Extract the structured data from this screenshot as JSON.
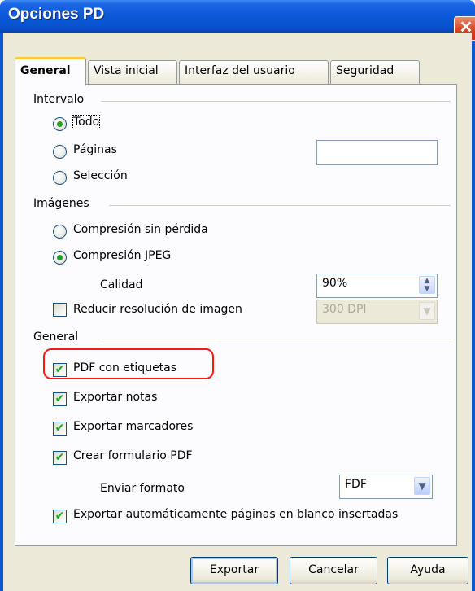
{
  "window": {
    "title": "Opciones PD",
    "close_glyph": "✕"
  },
  "tabs": [
    {
      "label": "General",
      "active": true
    },
    {
      "label": "Vista inicial",
      "active": false
    },
    {
      "label": "Interfaz del usuario",
      "active": false
    },
    {
      "label": "Seguridad",
      "active": false
    }
  ],
  "intervalo": {
    "heading": "Intervalo",
    "todo": "Todo",
    "paginas": "Páginas",
    "seleccion": "Selección",
    "selected": "Todo",
    "paginas_value": ""
  },
  "imagenes": {
    "heading": "Imágenes",
    "sin_perdida": "Compresión sin pérdida",
    "jpeg": "Compresión JPEG",
    "selected": "Compresión JPEG",
    "calidad_label": "Calidad",
    "calidad_value": "90%",
    "reducir_label": "Reducir resolución de imagen",
    "reducir_checked": false,
    "dpi_value": "300 DPI"
  },
  "general": {
    "heading": "General",
    "pdf_etiquetas": "PDF con etiquetas",
    "exportar_notas": "Exportar notas",
    "exportar_marcadores": "Exportar marcadores",
    "crear_formulario": "Crear formulario PDF",
    "enviar_formato_label": "Enviar formato",
    "enviar_formato_value": "FDF",
    "exportar_blanco": "Exportar automáticamente páginas en blanco insertadas",
    "check_glyph": "✔"
  },
  "buttons": {
    "exportar": "Exportar",
    "cancelar": "Cancelar",
    "ayuda": "Ayuda"
  },
  "colors": {
    "title_bar": "#0a5ad8",
    "dialog_bg": "#ece9d8",
    "highlight": "#ff1818",
    "check": "#21a121"
  }
}
